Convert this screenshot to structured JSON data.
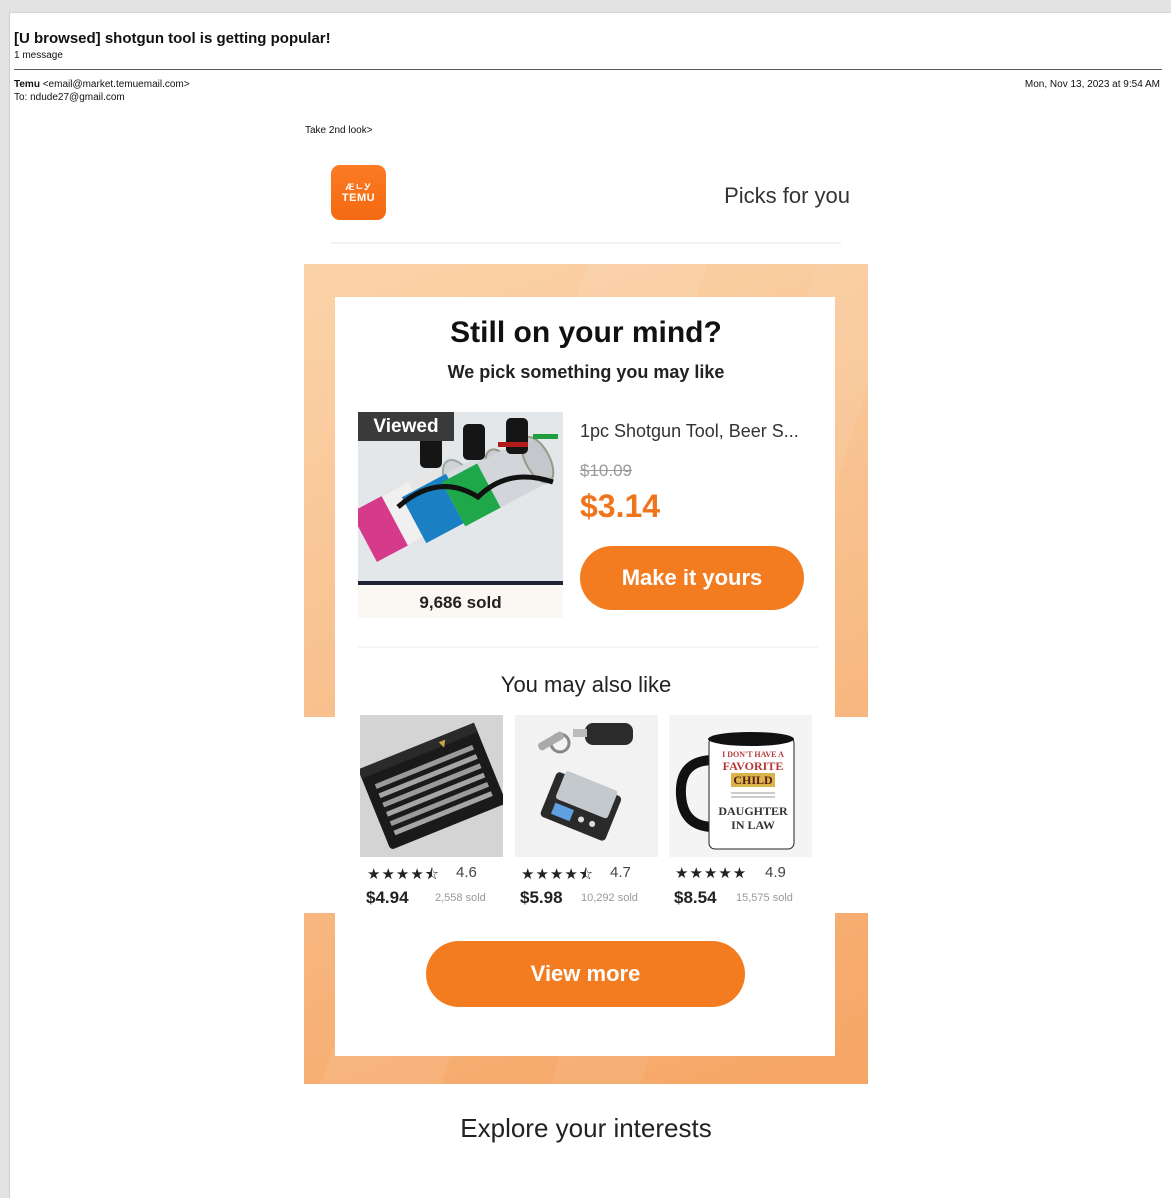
{
  "email": {
    "subject": "[U browsed] shotgun tool is getting popular!",
    "message_count": "1 message",
    "from_name": "Temu",
    "from_address": "<email@market.temuemail.com>",
    "to": "To: ndude27@gmail.com",
    "date": "Mon, Nov 13, 2023 at 9:54 AM",
    "preheader": "Take 2nd look>"
  },
  "brand": {
    "logo_glyph": "ÆㄴᎩ",
    "logo_text": "TEMU",
    "tagline": "Picks for you",
    "accent_color": "#f47c20"
  },
  "promo": {
    "headline": "Still on your mind?",
    "subline": "We pick something you may like"
  },
  "featured": {
    "badge": "Viewed",
    "title": "1pc Shotgun Tool, Beer S...",
    "old_price": "$10.09",
    "price": "$3.14",
    "sold": "9,686 sold",
    "cta": "Make it yours"
  },
  "also_like": {
    "heading": "You may also like",
    "items": [
      {
        "stars": "★★★★⯪",
        "rating": "4.6",
        "price": "$4.94",
        "sold": "2,558 sold",
        "image": "knife-set-in-box"
      },
      {
        "stars": "★★★★⯪",
        "rating": "4.7",
        "price": "$5.98",
        "sold": "10,292 sold",
        "image": "keychain-pocket-scale"
      },
      {
        "stars": "★★★★★",
        "rating": "4.9",
        "price": "$8.54",
        "sold": "15,575 sold",
        "image": "daughter-in-law-mug"
      }
    ],
    "mug_text": {
      "line1": "I DON'T HAVE A",
      "line2": "FAVORITE",
      "line3": "CHILD",
      "line4": "DAUGHTER",
      "line5": "IN LAW"
    }
  },
  "view_more": "View more",
  "explore": "Explore your interests"
}
